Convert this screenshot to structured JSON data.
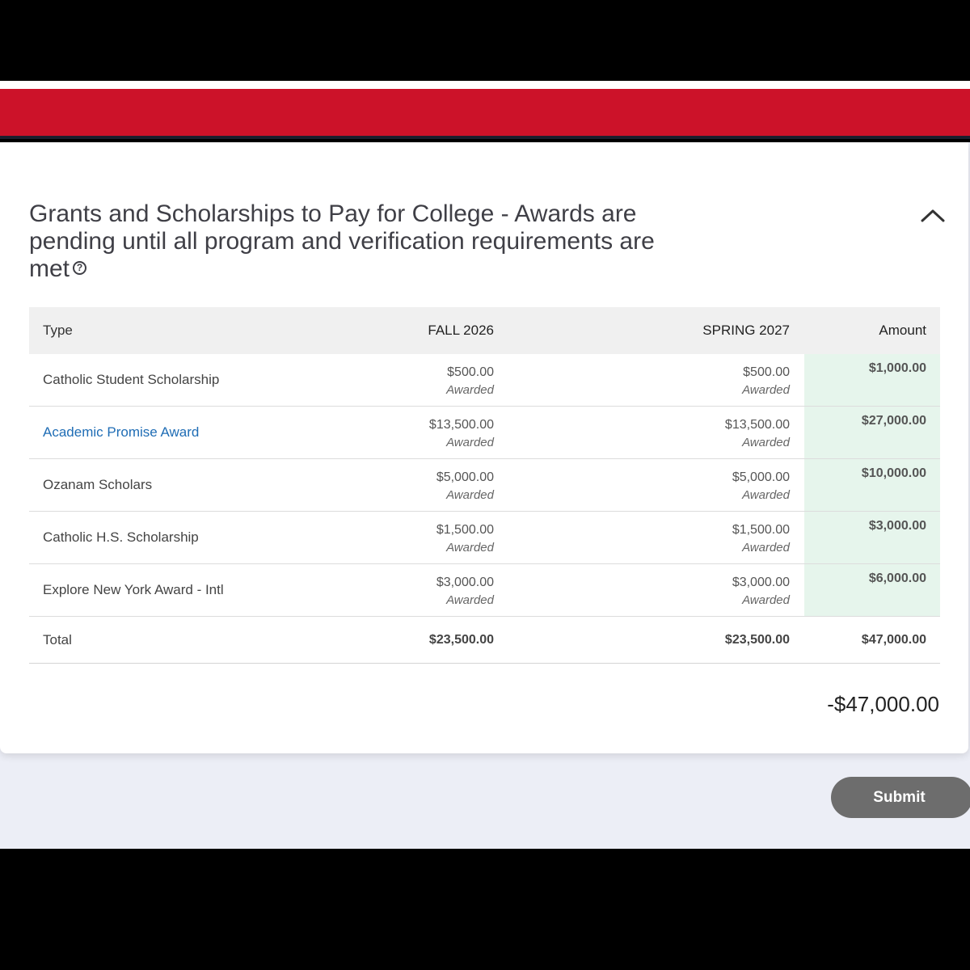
{
  "header": {
    "title": "Grants and Scholarships to Pay for College - Awards are pending until all program and verification requirements are met",
    "help_icon": "question-circle-icon",
    "collapse_icon": "chevron-up-icon"
  },
  "colors": {
    "brand_red": "#cc1229",
    "amount_highlight": "#e6f5ec",
    "link_blue": "#1f6db5",
    "submit_gray": "#6d6d6d"
  },
  "table": {
    "columns": [
      "Type",
      "FALL 2026",
      "SPRING 2027",
      "Amount"
    ],
    "rows": [
      {
        "type": "Catholic Student Scholarship",
        "fall": "$500.00",
        "fall_status": "Awarded",
        "spring": "$500.00",
        "spring_status": "Awarded",
        "amount": "$1,000.00"
      },
      {
        "type": "Academic Promise Award",
        "fall": "$13,500.00",
        "fall_status": "Awarded",
        "spring": "$13,500.00",
        "spring_status": "Awarded",
        "amount": "$27,000.00"
      },
      {
        "type": "Ozanam Scholars",
        "fall": "$5,000.00",
        "fall_status": "Awarded",
        "spring": "$5,000.00",
        "spring_status": "Awarded",
        "amount": "$10,000.00"
      },
      {
        "type": "Catholic H.S. Scholarship",
        "fall": "$1,500.00",
        "fall_status": "Awarded",
        "spring": "$1,500.00",
        "spring_status": "Awarded",
        "amount": "$3,000.00"
      },
      {
        "type": "Explore New York Award - Intl",
        "fall": "$3,000.00",
        "fall_status": "Awarded",
        "spring": "$3,000.00",
        "spring_status": "Awarded",
        "amount": "$6,000.00"
      }
    ],
    "total": {
      "label": "Total",
      "fall": "$23,500.00",
      "spring": "$23,500.00",
      "amount": "$47,000.00"
    }
  },
  "grand_total": "-$47,000.00",
  "submit_label": "Submit"
}
